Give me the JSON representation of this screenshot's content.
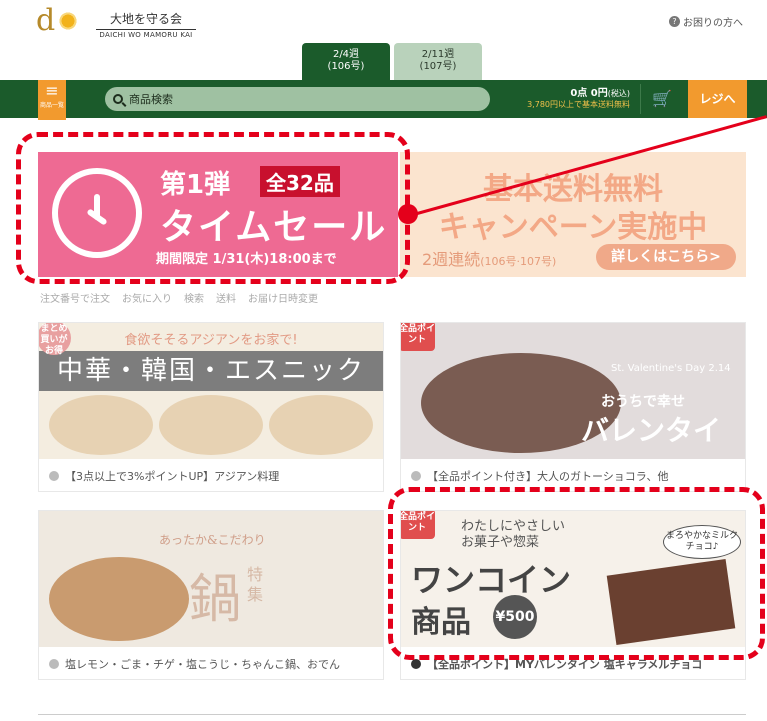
{
  "header": {
    "logo_letter": "d",
    "logo_jp": "大地を守る会",
    "logo_en": "DAICHI WO MAMORU KAI",
    "help_label": "お困りの方へ"
  },
  "week_tabs": [
    {
      "label": "2/4週",
      "sub": "(106号)",
      "active": true
    },
    {
      "label": "2/11週",
      "sub": "(107号)",
      "active": false
    }
  ],
  "navbar": {
    "menu_label": "商品一覧",
    "search_placeholder": "商品検索",
    "points_line": "0点 0円",
    "points_tax": "(税込)",
    "shipping_note": "3,780円以上で基本送料無料",
    "register_label": "レジへ"
  },
  "banners": {
    "timesale": {
      "title": "第1弾",
      "badge": "全32品",
      "main": "タイムセール",
      "period": "期間限定 1/31(木)18:00まで"
    },
    "campaign": {
      "line1": "基本送料無料",
      "line2": "キャンペーン実施中",
      "foot": "2週連続",
      "foot_sub": "(106号·107号)",
      "button": "詳しくはこちら>"
    }
  },
  "quick_links": [
    "注文番号で注文",
    "お気に入り",
    "検索",
    "送料",
    "お届け日時変更"
  ],
  "cards": [
    {
      "tag": "まとめ買いがお得",
      "top": "食欲そそるアジアンをお家で!",
      "middle": "中華・韓国・エスニック",
      "caption": "【3点以上で3%ポイントUP】アジアン料理"
    },
    {
      "tag": "全品ポイント",
      "t1": "St. Valentine's Day 2.14",
      "t2": "おうちで幸せ",
      "t3": "バレンタイン",
      "caption": "【全品ポイント付き】大人のガトーショコラ、他"
    },
    {
      "sub": "あったか&こだわり",
      "big": "鍋",
      "side": "特集",
      "caption": "塩レモン・ごま・チゲ・塩こうじ・ちゃんこ鍋、おでん"
    },
    {
      "tag": "全品ポイント",
      "t1": "わたしにやさしい",
      "t2": "お菓子や惣菜",
      "t3": "ワンコイン",
      "t4": "商品",
      "coin": "¥500",
      "bubble": "まろやかなミルクチョコ♪",
      "caption": "【全品ポイント】MYバレンタイン 塩キャラメルチョコ"
    }
  ],
  "colors": {
    "brand_green": "#1b5b2b",
    "accent_orange": "#f29a2e",
    "annotation_red": "#e4001b",
    "timesale_pink": "#ee6a93"
  }
}
